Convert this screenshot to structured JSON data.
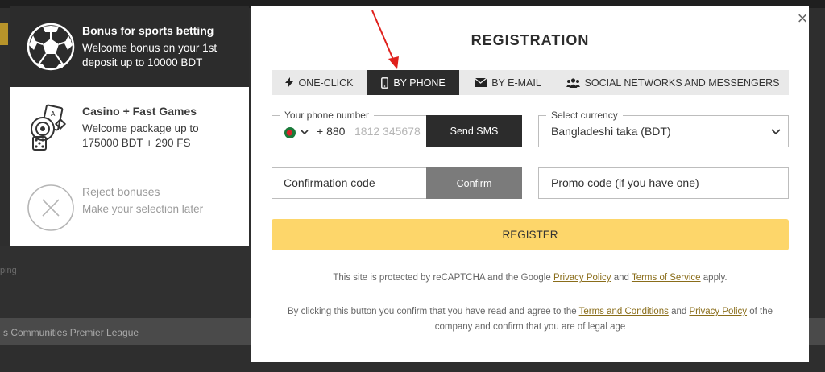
{
  "background": {
    "league_text": "s Communities Premier League",
    "ping_text": "ping"
  },
  "bonuses": [
    {
      "title": "Bonus for sports betting",
      "desc": "Welcome bonus on your 1st deposit up to 10000 BDT",
      "icon": "soccer-ball-icon"
    },
    {
      "title": "Casino + Fast Games",
      "desc": "Welcome package up to 175000 BDT + 290 FS",
      "icon": "casino-chip-icon"
    },
    {
      "title": "Reject bonuses",
      "desc": "Make your selection later",
      "icon": "close-circle-icon"
    }
  ],
  "modal": {
    "title": "REGISTRATION",
    "close_label": "×",
    "tabs": [
      {
        "label": "ONE-CLICK",
        "icon": "lightning-icon"
      },
      {
        "label": "BY PHONE",
        "icon": "phone-icon"
      },
      {
        "label": "BY E-MAIL",
        "icon": "envelope-icon"
      },
      {
        "label": "SOCIAL NETWORKS AND MESSENGERS",
        "icon": "users-icon"
      }
    ],
    "phone": {
      "legend": "Your phone number",
      "code": "+ 880",
      "placeholder": "1812 345678",
      "send_sms": "Send SMS"
    },
    "currency": {
      "legend": "Select currency",
      "value": "Bangladeshi taka (BDT)"
    },
    "confirmation": {
      "placeholder": "Confirmation code",
      "confirm": "Confirm"
    },
    "promo": {
      "placeholder": "Promo code (if you have one)"
    },
    "register": "REGISTER",
    "recaptcha": {
      "prefix": "This site is protected by reCAPTCHA and the Google",
      "privacy": "Privacy Policy",
      "and": "and",
      "terms": "Terms of Service",
      "suffix": "apply."
    },
    "agree": {
      "prefix": "By clicking this button you confirm that you have read and agree to the",
      "terms": "Terms and Conditions",
      "and": "and",
      "privacy": "Privacy Policy",
      "suffix": "of the company and confirm that you are of legal age"
    }
  },
  "colors": {
    "accent": "#fdd66a",
    "dark": "#2c2c2c",
    "link": "#8a6d1a",
    "annotation_arrow": "#e0201c"
  }
}
